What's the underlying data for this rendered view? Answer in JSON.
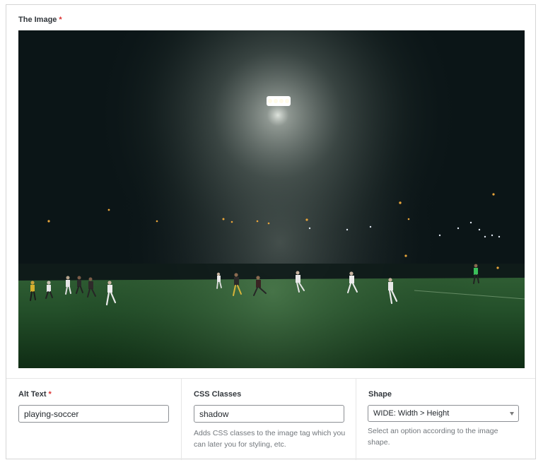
{
  "image_field": {
    "label": "The Image",
    "required_mark": "*"
  },
  "alt_text": {
    "label": "Alt Text",
    "required_mark": "*",
    "value": "playing-soccer"
  },
  "css_classes": {
    "label": "CSS Classes",
    "value": "shadow",
    "help": "Adds CSS classes to the image tag which you can later you for styling, etc."
  },
  "shape": {
    "label": "Shape",
    "selected": "WIDE: Width > Height",
    "help": "Select an option according to the image shape."
  },
  "colors": {
    "required": "#dc3232",
    "sky": "#0b1517",
    "field": "#1f4a22"
  }
}
